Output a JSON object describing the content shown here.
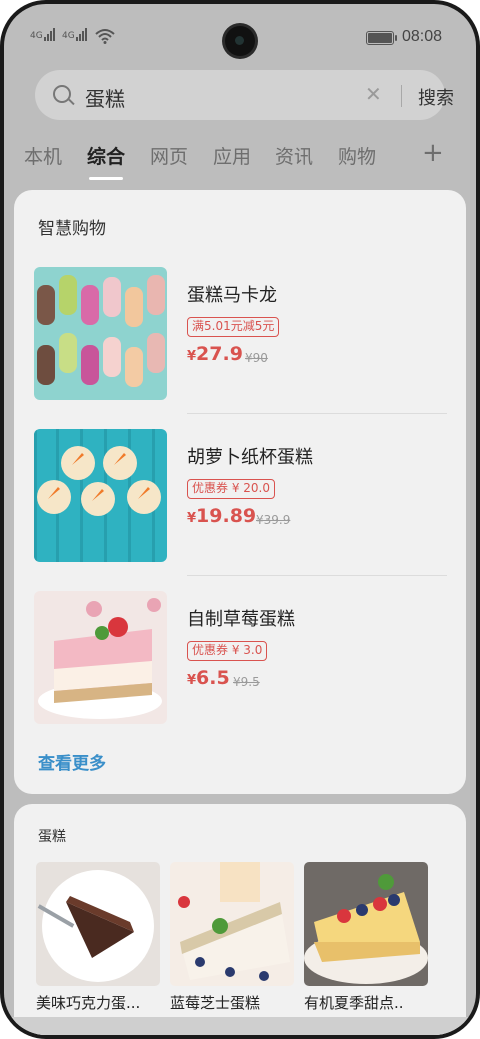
{
  "status_bar": {
    "signal1": "4G",
    "signal2": "4G",
    "time": "08:08"
  },
  "search": {
    "query": "蛋糕",
    "clear_icon": "close-icon",
    "button_label": "搜索"
  },
  "tabs": [
    {
      "label": "本机",
      "active": false
    },
    {
      "label": "综合",
      "active": true
    },
    {
      "label": "网页",
      "active": false
    },
    {
      "label": "应用",
      "active": false
    },
    {
      "label": "资讯",
      "active": false
    },
    {
      "label": "购物",
      "active": false
    }
  ],
  "add_tab_label": "+",
  "smart_shopping": {
    "title": "智慧购物",
    "products": [
      {
        "name": "蛋糕马卡龙",
        "tag": "满5.01元减5元",
        "currency": "¥",
        "price": "27.9",
        "original": "¥90"
      },
      {
        "name": "胡萝卜纸杯蛋糕",
        "tag": "优惠券 ¥ 20.0",
        "currency": "¥",
        "price": "19.89",
        "original": "¥39.9"
      },
      {
        "name": "自制草莓蛋糕",
        "tag": "优惠券 ¥ 3.0",
        "currency": "¥",
        "price": "6.5",
        "original": "¥9.5"
      }
    ],
    "see_more": "查看更多"
  },
  "cake_section": {
    "title": "蛋糕",
    "items": [
      {
        "name": "美味巧克力蛋..."
      },
      {
        "name": "蓝莓芝士蛋糕"
      },
      {
        "name": "有机夏季甜点.."
      }
    ]
  },
  "colors": {
    "accent_price": "#d9534f",
    "link": "#3a8fc9"
  }
}
